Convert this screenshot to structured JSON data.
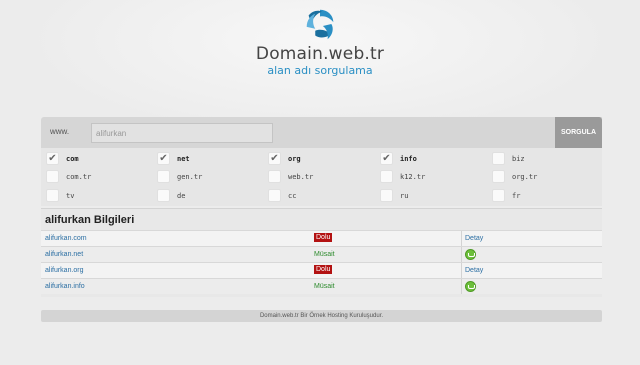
{
  "header": {
    "logo_text": "Domain.web.tr",
    "tagline": "alan adı sorgulama"
  },
  "search": {
    "prefix_label": "www.",
    "input_value": "alifurkan",
    "button_label": "SORGULA"
  },
  "tlds": [
    {
      "label": "com",
      "checked": true
    },
    {
      "label": "net",
      "checked": true
    },
    {
      "label": "org",
      "checked": true
    },
    {
      "label": "info",
      "checked": true
    },
    {
      "label": "biz",
      "checked": false
    },
    {
      "label": "com.tr",
      "checked": false
    },
    {
      "label": "gen.tr",
      "checked": false
    },
    {
      "label": "web.tr",
      "checked": false
    },
    {
      "label": "k12.tr",
      "checked": false
    },
    {
      "label": "org.tr",
      "checked": false
    },
    {
      "label": "tv",
      "checked": false
    },
    {
      "label": "de",
      "checked": false
    },
    {
      "label": "cc",
      "checked": false
    },
    {
      "label": "ru",
      "checked": false
    },
    {
      "label": "fr",
      "checked": false
    }
  ],
  "results": {
    "title": "alifurkan Bilgileri",
    "rows": [
      {
        "domain": "alifurkan.com",
        "status": "Dolu",
        "action": "Detay"
      },
      {
        "domain": "alifurkan.net",
        "status": "Müsait",
        "action_icon": "cart-icon"
      },
      {
        "domain": "alifurkan.org",
        "status": "Dolu",
        "action": "Detay"
      },
      {
        "domain": "alifurkan.info",
        "status": "Müsait",
        "action_icon": "cart-icon"
      }
    ]
  },
  "footer": {
    "text": "Domain.web.tr Bir Örnek Hosting Kuruluşudur."
  },
  "colors": {
    "brand_blue": "#2a8fc4",
    "status_taken": "#b31212",
    "status_available": "#2e8b2e",
    "link": "#2c6fa3"
  }
}
